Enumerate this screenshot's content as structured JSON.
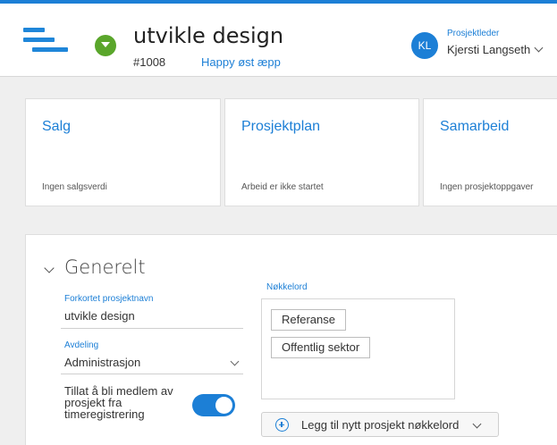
{
  "header": {
    "menu_icon": "hamburger-menu-icon",
    "status_icon": "status-dropdown-icon",
    "status_color": "#5aa62b",
    "title": "utvikle design",
    "project_number": "#1008",
    "client": "Happy øst æpp",
    "manager_role": "Prosjektleder",
    "manager_initials": "KL",
    "manager_name": "Kjersti Langseth"
  },
  "cards": [
    {
      "title": "Salg",
      "subtitle": "Ingen salgsverdi"
    },
    {
      "title": "Prosjektplan",
      "subtitle": "Arbeid er ikke startet"
    },
    {
      "title": "Samarbeid",
      "subtitle": "Ingen prosjektoppgaver"
    }
  ],
  "general": {
    "section_title": "Generelt",
    "short_name_label": "Forkortet prosjektnavn",
    "short_name_value": "utvikle design",
    "department_label": "Avdeling",
    "department_value": "Administrasjon",
    "time_toggle_label": "Tillat å bli medlem av prosjekt fra timeregistrering",
    "time_toggle_on": true,
    "keywords_label": "Nøkkelord",
    "keywords": [
      "Referanse",
      "Offentlig sektor"
    ],
    "add_keyword_label": "Legg til nytt prosjekt nøkkelord"
  },
  "colors": {
    "accent": "#1c7fd6",
    "status": "#5aa62b"
  }
}
